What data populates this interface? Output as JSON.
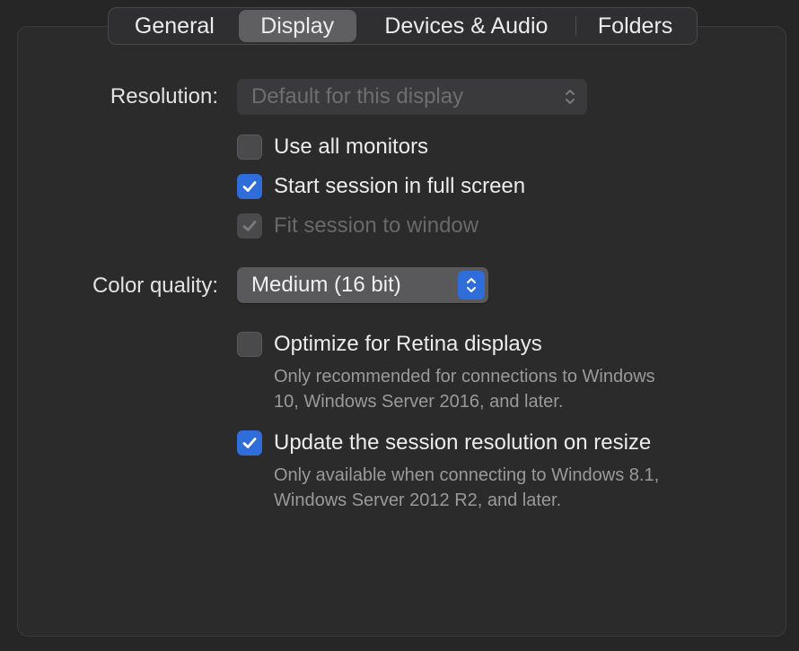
{
  "tabs": [
    {
      "label": "General",
      "selected": false
    },
    {
      "label": "Display",
      "selected": true
    },
    {
      "label": "Devices & Audio",
      "selected": false
    },
    {
      "label": "Folders",
      "selected": false
    }
  ],
  "resolution": {
    "label": "Resolution:",
    "value": "Default for this display",
    "enabled": false
  },
  "options": {
    "use_all_monitors": {
      "label": "Use all monitors",
      "checked": false,
      "enabled": true
    },
    "full_screen": {
      "label": "Start session in full screen",
      "checked": true,
      "enabled": true
    },
    "fit_to_window": {
      "label": "Fit session to window",
      "checked": true,
      "enabled": false
    }
  },
  "color_quality": {
    "label": "Color quality:",
    "value": "Medium (16 bit)"
  },
  "retina": {
    "label": "Optimize for Retina displays",
    "checked": false,
    "hint_line1": "Only recommended for connections to Windows",
    "hint_line2": "10, Windows Server 2016, and later."
  },
  "update_resolution": {
    "label": "Update the session resolution on resize",
    "checked": true,
    "hint_line1": "Only available when connecting to Windows 8.1,",
    "hint_line2": "Windows Server 2012 R2, and later."
  },
  "colors": {
    "accent": "#2f6ddb",
    "background": "#262627",
    "panel": "#2b2b2c"
  }
}
